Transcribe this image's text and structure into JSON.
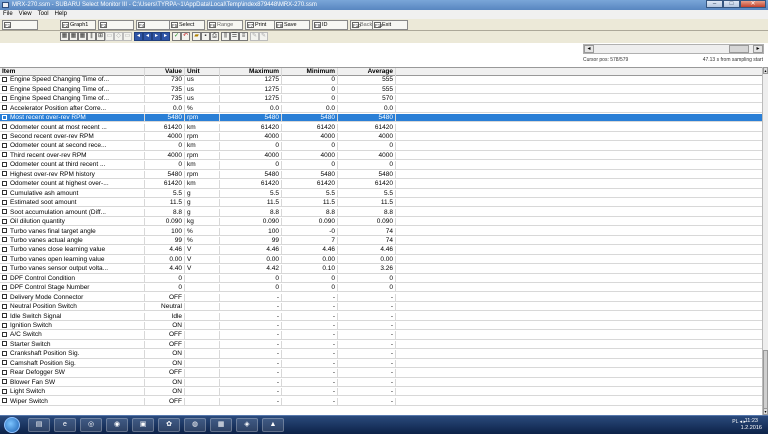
{
  "window": {
    "title": "MRX-270.ssm - SUBARU Select Monitor III - C:\\Users\\TYRPA~1\\AppData\\Local\\Temp\\index879448\\MRX-270.ssm"
  },
  "menu": [
    "File",
    "View",
    "Tool",
    "Help"
  ],
  "tabs": [
    {
      "key": "F2",
      "label": "Graph1"
    },
    {
      "key": "F3",
      "label": ""
    },
    {
      "key": "F4",
      "label": ""
    },
    {
      "key": "F5",
      "label": "Select"
    },
    {
      "key": "F6",
      "label": "Range"
    },
    {
      "key": "F7",
      "label": "Print"
    },
    {
      "key": "F8",
      "label": "Save"
    },
    {
      "key": "F9",
      "label": "ID"
    },
    {
      "key": "F10",
      "label": "Back"
    },
    {
      "key": "F11",
      "label": "Exit"
    }
  ],
  "toolbar": {
    "icons": [
      "grid-icon",
      "grid-icon",
      "grid-icon",
      "bars-icon",
      "bars-icon",
      "bars-icon",
      "box-icon",
      "box-icon",
      "box-icon",
      "skip-back-icon",
      "step-back-icon",
      "step-forward-icon",
      "skip-forward-icon",
      "check-icon",
      "undo-icon",
      "folder-icon",
      "save-icon",
      "print-icon",
      "columns-icon",
      "list-icon",
      "list-icon",
      "pen-icon",
      "pen-icon"
    ]
  },
  "status": {
    "cursor_pos": "Cursor pos: 578/579",
    "rate": "47.13 s from sampling start"
  },
  "table": {
    "headers": {
      "item": "Item",
      "value": "Value",
      "unit": "Unit",
      "max": "Maximum",
      "min": "Minimum",
      "avg": "Average"
    },
    "selected_index": 4,
    "rows": [
      [
        "Engine Speed Changing Time of...",
        "730",
        "us",
        "1275",
        "0",
        "555"
      ],
      [
        "Engine Speed Changing Time of...",
        "735",
        "us",
        "1275",
        "0",
        "555"
      ],
      [
        "Engine Speed Changing Time of...",
        "735",
        "us",
        "1275",
        "0",
        "570"
      ],
      [
        "Accelerator Position after Corre...",
        "0.0",
        "%",
        "0.0",
        "0.0",
        "0.0"
      ],
      [
        "Most recent over-rev RPM",
        "5480",
        "rpm",
        "5480",
        "5480",
        "5480"
      ],
      [
        "Odometer count at most recent ...",
        "61420",
        "km",
        "61420",
        "61420",
        "61420"
      ],
      [
        "Second recent over-rev RPM",
        "4000",
        "rpm",
        "4000",
        "4000",
        "4000"
      ],
      [
        "Odometer count at second rece...",
        "0",
        "km",
        "0",
        "0",
        "0"
      ],
      [
        "Third recent over-rev RPM",
        "4000",
        "rpm",
        "4000",
        "4000",
        "4000"
      ],
      [
        "Odometer count at third recent ...",
        "0",
        "km",
        "0",
        "0",
        "0"
      ],
      [
        "Highest over-rev RPM history",
        "5480",
        "rpm",
        "5480",
        "5480",
        "5480"
      ],
      [
        "Odometer count at highest over-...",
        "61420",
        "km",
        "61420",
        "61420",
        "61420"
      ],
      [
        "Cumulative ash amount",
        "5.5",
        "g",
        "5.5",
        "5.5",
        "5.5"
      ],
      [
        "Estimated soot amount",
        "11.5",
        "g",
        "11.5",
        "11.5",
        "11.5"
      ],
      [
        "Soot accumulation amount (Diff...",
        "8.8",
        "g",
        "8.8",
        "8.8",
        "8.8"
      ],
      [
        "Oil dilution quantity",
        "0.090",
        "kg",
        "0.090",
        "0.090",
        "0.090"
      ],
      [
        "Turbo vanes final target angle",
        "100",
        "%",
        "100",
        "-0",
        "74"
      ],
      [
        "Turbo vanes actual angle",
        "99",
        "%",
        "99",
        "7",
        "74"
      ],
      [
        "Turbo vanes close learning value",
        "4.46",
        "V",
        "4.46",
        "4.46",
        "4.46"
      ],
      [
        "Turbo vanes open learning value",
        "0.00",
        "V",
        "0.00",
        "0.00",
        "0.00"
      ],
      [
        "Turbo vanes sensor output volta...",
        "4.40",
        "V",
        "4.42",
        "0.10",
        "3.26"
      ],
      [
        "DPF Control Condition",
        "0",
        "",
        "0",
        "0",
        "0"
      ],
      [
        "DPF Control Stage Number",
        "0",
        "",
        "0",
        "0",
        "0"
      ],
      [
        "Delivery Mode Connector",
        "OFF",
        "",
        "-",
        "-",
        "-"
      ],
      [
        "Neutral Position Switch",
        "Neutral",
        "",
        "-",
        "-",
        "-"
      ],
      [
        "Idle Switch Signal",
        "Idle",
        "",
        "-",
        "-",
        "-"
      ],
      [
        "Ignition Switch",
        "ON",
        "",
        "-",
        "-",
        "-"
      ],
      [
        "A/C Switch",
        "OFF",
        "",
        "-",
        "-",
        "-"
      ],
      [
        "Starter Switch",
        "OFF",
        "",
        "-",
        "-",
        "-"
      ],
      [
        "Crankshaft Position Sig.",
        "ON",
        "",
        "-",
        "-",
        "-"
      ],
      [
        "Camshaft Position Sig.",
        "ON",
        "",
        "-",
        "-",
        "-"
      ],
      [
        "Rear Defogger SW",
        "OFF",
        "",
        "-",
        "-",
        "-"
      ],
      [
        "Blower Fan SW",
        "ON",
        "",
        "-",
        "-",
        "-"
      ],
      [
        "Light Switch",
        "ON",
        "",
        "-",
        "-",
        "-"
      ],
      [
        "Wiper Switch",
        "OFF",
        "",
        "-",
        "-",
        "-"
      ]
    ]
  },
  "taskbar": {
    "apps": [
      "explorer-icon",
      "ie-icon",
      "ssm-icon",
      "firefox-icon",
      "photo-icon",
      "app-icon",
      "spotify-icon",
      "remote-icon",
      "ssm-active-icon",
      "pdf-icon"
    ],
    "app_glyphs": [
      "▤",
      "e",
      "◎",
      "◉",
      "▣",
      "✿",
      "◍",
      "▦",
      "◈",
      "▲"
    ],
    "tray_text": "PL ◂ ▸",
    "time": "11:23",
    "date": "1.2.2016"
  },
  "colors": {
    "selection": "#2a7fd6",
    "titlebar": "#5886c0",
    "taskbar": "#0d2248"
  }
}
